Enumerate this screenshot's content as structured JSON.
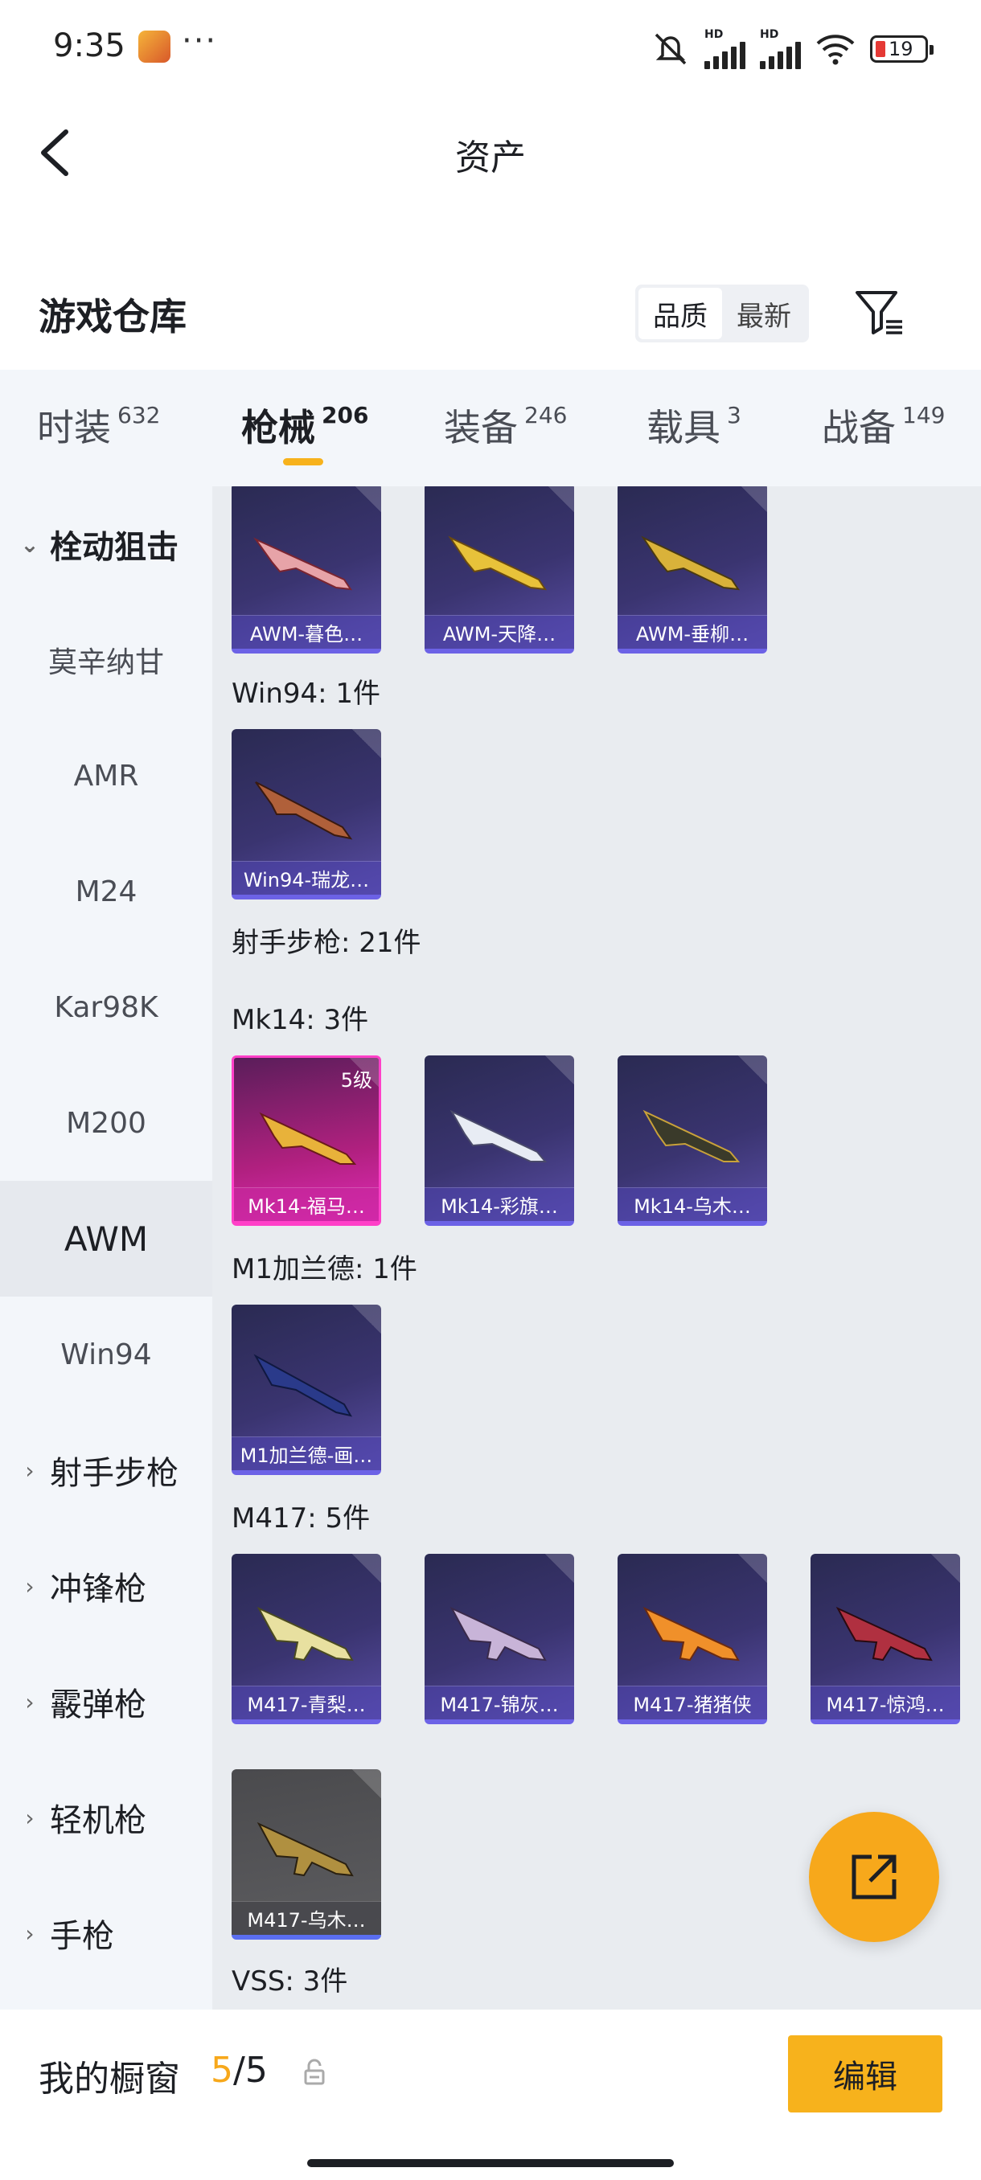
{
  "status": {
    "time": "9:35",
    "dots": "···",
    "battery": "19",
    "hd1": "HD",
    "hd2": "HD"
  },
  "header": {
    "title": "资产"
  },
  "section": {
    "title": "游戏仓库",
    "sort": [
      "品质",
      "最新"
    ]
  },
  "tabs": [
    {
      "label": "时装",
      "count": "632"
    },
    {
      "label": "枪械",
      "count": "206"
    },
    {
      "label": "装备",
      "count": "246"
    },
    {
      "label": "载具",
      "count": "3"
    },
    {
      "label": "战备",
      "count": "149"
    }
  ],
  "sidebar": {
    "group_expanded": "栓动狙击",
    "subs": [
      "莫辛纳甘",
      "AMR",
      "M24",
      "Kar98K",
      "M200",
      "AWM",
      "Win94"
    ],
    "groups": [
      "射手步枪",
      "冲锋枪",
      "霰弹枪",
      "轻机枪",
      "手枪"
    ]
  },
  "content": {
    "awm_cards": [
      "AWM-暮色…",
      "AWM-天降…",
      "AWM-垂柳…"
    ],
    "win94_heading": "Win94: 1件",
    "win94_cards": [
      "Win94-瑞龙…"
    ],
    "dmr_heading": "射手步枪: 21件",
    "mk14_heading": "Mk14: 3件",
    "mk14_cards": [
      "Mk14-福马…",
      "Mk14-彩旗…",
      "Mk14-乌木…"
    ],
    "mk14_level": "5级",
    "m1_heading": "M1加兰德: 1件",
    "m1_cards": [
      "M1加兰德-画…"
    ],
    "m417_heading": "M417: 5件",
    "m417_cards": [
      "M417-青梨…",
      "M417-锦灰…",
      "M417-猪猪侠",
      "M417-惊鸿…",
      "M417-乌木…"
    ],
    "vss_heading": "VSS: 3件"
  },
  "bottom": {
    "label": "我的橱窗",
    "count_current": "5",
    "count_sep": "/",
    "count_total": "5",
    "edit": "编辑"
  },
  "colors": {
    "accent": "#f7b21c",
    "card_blue": "#3a3470",
    "card_pink": "#e02bb6"
  }
}
